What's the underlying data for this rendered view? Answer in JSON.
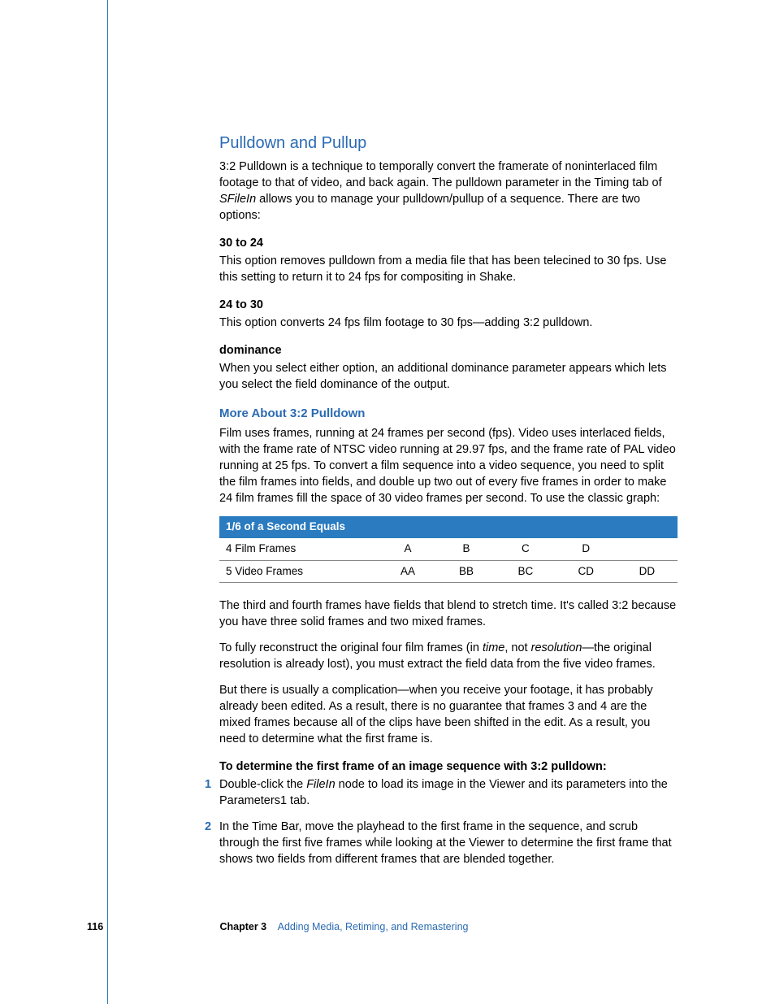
{
  "section_title": "Pulldown and Pullup",
  "intro_before_italic": "3:2 Pulldown is a technique to temporally convert the framerate of noninterlaced film footage to that of video, and back again. The pulldown parameter in the Timing tab of ",
  "intro_italic": "SFileIn",
  "intro_after_italic": " allows you to manage your pulldown/pullup of a sequence. There are two options:",
  "h30": "30 to 24",
  "p30": "This option removes pulldown from a media file that has been telecined to 30 fps. Use this setting to return it to 24 fps for compositing in Shake.",
  "h24": "24 to 30",
  "p24": "This option converts 24 fps film footage to 30 fps—adding 3:2 pulldown.",
  "hdom": "dominance",
  "pdom": "When you select either option, an additional dominance parameter appears which lets you select the field dominance of the output.",
  "more_title": "More About 3:2 Pulldown",
  "more_para": "Film uses frames, running at 24 frames per second (fps). Video uses interlaced fields, with the frame rate of NTSC video running at 29.97 fps, and the frame rate of PAL video running at 25 fps. To convert a film sequence into a video sequence, you need to split the film frames into fields, and double up two out of every five frames in order to make 24 film frames fill the space of 30 video frames per second. To use the classic graph:",
  "table": {
    "header": "1/6 of a Second Equals",
    "row1_label": "4 Film Frames",
    "row1": [
      "A",
      "B",
      "C",
      "D",
      ""
    ],
    "row2_label": "5 Video Frames",
    "row2": [
      "AA",
      "BB",
      "BC",
      "CD",
      "DD"
    ]
  },
  "para_third": "The third and fourth frames have fields that blend to stretch time. It's called 3:2 because you have three solid frames and two mixed frames.",
  "para_recon_a": "To fully reconstruct the original four film frames (in ",
  "para_recon_time": "time",
  "para_recon_b": ", not ",
  "para_recon_res": "resolution",
  "para_recon_c": "—the original resolution is already lost), you must extract the field data from the five video frames.",
  "para_complication": "But there is usually a complication—when you receive your footage, it has probably already been edited. As a result, there is no guarantee that frames 3 and 4 are the mixed frames because all of the clips have been shifted in the edit. As a result, you need to determine what the first frame is.",
  "steps_title": "To determine the first frame of an image sequence with 3:2 pulldown:",
  "step1_num": "1",
  "step1_a": "Double-click the ",
  "step1_ital": "FileIn",
  "step1_b": " node to load its image in the Viewer and its parameters into the Parameters1 tab.",
  "step2_num": "2",
  "step2": "In the Time Bar, move the playhead to the first frame in the sequence, and scrub through the first five frames while looking at the Viewer to determine the first frame that shows two fields from different frames that are blended together.",
  "page_number": "116",
  "chapter_label": "Chapter 3",
  "chapter_title": "Adding Media, Retiming, and Remastering"
}
